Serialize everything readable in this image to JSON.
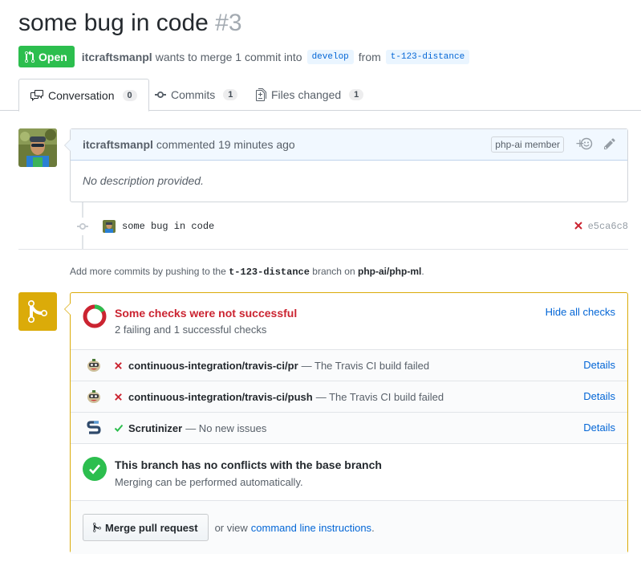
{
  "pr": {
    "title": "some bug in code",
    "number": "#3"
  },
  "meta": {
    "state": "Open",
    "author": "itcraftsmanpl",
    "text_merge": "wants to merge 1 commit into",
    "base_branch": "develop",
    "text_from": "from",
    "head_branch": "t-123-distance"
  },
  "tabs": [
    {
      "label": "Conversation",
      "count": "0"
    },
    {
      "label": "Commits",
      "count": "1"
    },
    {
      "label": "Files changed",
      "count": "1"
    }
  ],
  "comment": {
    "author": "itcraftsmanpl",
    "action": "commented 19 minutes ago",
    "role": "php-ai member",
    "body": "No description provided."
  },
  "commit": {
    "message": "some bug in code",
    "sha": "e5ca6c8"
  },
  "push_note": {
    "prefix": "Add more commits by pushing to the",
    "branch": "t-123-distance",
    "middle": "branch on",
    "repo": "php-ai/php-ml",
    "suffix": "."
  },
  "checks": {
    "title": "Some checks were not successful",
    "subtitle": "2 failing and 1 successful checks",
    "hide_label": "Hide all checks",
    "items": [
      {
        "name": "continuous-integration/travis-ci/pr",
        "description": "— The Travis CI build failed",
        "status": "failed",
        "details": "Details"
      },
      {
        "name": "continuous-integration/travis-ci/push",
        "description": "— The Travis CI build failed",
        "status": "failed",
        "details": "Details"
      },
      {
        "name": "Scrutinizer",
        "description": "— No new issues",
        "status": "success",
        "details": "Details"
      }
    ]
  },
  "conflicts": {
    "title": "This branch has no conflicts with the base branch",
    "subtitle": "Merging can be performed automatically."
  },
  "merge": {
    "button": "Merge pull request",
    "or_view": "or view",
    "link": "command line instructions",
    "suffix": "."
  },
  "colors": {
    "open_green": "#2cbe4e",
    "fail_red": "#cb2431",
    "merge_yellow": "#dbab09",
    "link_blue": "#0366d6"
  }
}
